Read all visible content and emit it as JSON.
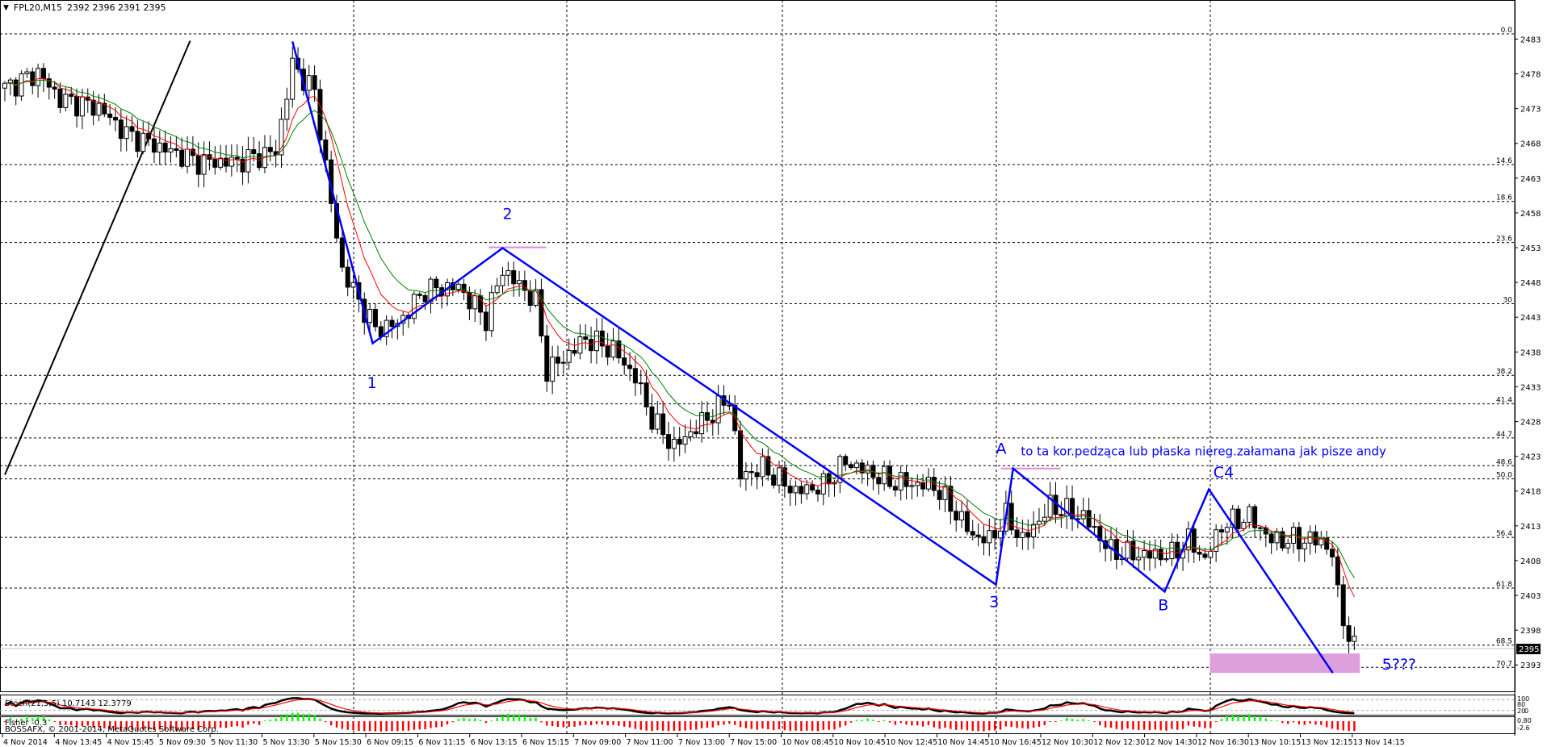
{
  "header": {
    "symbol": "FPL20,M15",
    "ohlc": "2392 2396 2391 2395"
  },
  "colors": {
    "bull_fill": "#ffffff",
    "bear_fill": "#000000",
    "ma_fast": "#ff0000",
    "ma_slow": "#008000",
    "wave": "#0000ff",
    "zone": "#dda0dd",
    "grid": "#000000",
    "fisher_up": "#00ff00",
    "fisher_down": "#ff0000"
  },
  "chart_data": {
    "type": "candlestick",
    "title": "FPL20,M15",
    "candle_count": 245,
    "close_keypoints": [
      [
        0,
        2475.6
      ],
      [
        6,
        2477.8
      ],
      [
        10,
        2474
      ],
      [
        17,
        2472.8
      ],
      [
        22,
        2469
      ],
      [
        30,
        2466.5
      ],
      [
        35,
        2465
      ],
      [
        42,
        2465
      ],
      [
        49,
        2466.5
      ],
      [
        52,
        2479
      ],
      [
        56,
        2475
      ],
      [
        59,
        2459
      ],
      [
        61,
        2449.5
      ],
      [
        64,
        2445
      ],
      [
        67,
        2441
      ],
      [
        71,
        2441.7
      ],
      [
        76,
        2446.6
      ],
      [
        82,
        2447
      ],
      [
        87,
        2442.4
      ],
      [
        90,
        2449.5
      ],
      [
        96,
        2445
      ],
      [
        98,
        2435
      ],
      [
        101,
        2436.7
      ],
      [
        105,
        2439.6
      ],
      [
        110,
        2438
      ],
      [
        114,
        2434
      ],
      [
        117,
        2428
      ],
      [
        121,
        2424
      ],
      [
        125,
        2426.8
      ],
      [
        131,
        2431
      ],
      [
        133,
        2419.8
      ],
      [
        137,
        2421
      ],
      [
        143,
        2417.6
      ],
      [
        148,
        2418.4
      ],
      [
        152,
        2421.9
      ],
      [
        160,
        2419
      ],
      [
        168,
        2418.4
      ],
      [
        171,
        2415.5
      ],
      [
        175,
        2411.3
      ],
      [
        178,
        2410.6
      ],
      [
        181,
        2414
      ],
      [
        184,
        2410.6
      ],
      [
        189,
        2415.5
      ],
      [
        195,
        2414
      ],
      [
        200,
        2409
      ],
      [
        205,
        2408.5
      ],
      [
        211,
        2408.5
      ],
      [
        214,
        2410.6
      ],
      [
        217,
        2407.8
      ],
      [
        220,
        2412.7
      ],
      [
        225,
        2414
      ],
      [
        229,
        2410.6
      ],
      [
        238,
        2410.6
      ],
      [
        240,
        2408.5
      ],
      [
        241,
        2402.8
      ],
      [
        243,
        2396.4
      ],
      [
        244,
        2395
      ]
    ],
    "last_price": 2395,
    "y_axis": {
      "ylim": [
        2389,
        2488
      ],
      "ticks": [
        "2483",
        "2478",
        "2473",
        "2468",
        "2463",
        "2458",
        "2453",
        "2448",
        "2443",
        "2438",
        "2433",
        "2428",
        "2423",
        "2418",
        "2413",
        "2408",
        "2403",
        "2398",
        "2393"
      ],
      "tick_values": [
        2483,
        2478,
        2473,
        2468,
        2463,
        2458,
        2453,
        2448,
        2443,
        2438,
        2433,
        2428,
        2423,
        2418,
        2413,
        2408,
        2403,
        2398,
        2393
      ]
    },
    "fib_levels": [
      {
        "label": "0.0",
        "price": 2483.4
      },
      {
        "label": "14.6",
        "price": 2464.6
      },
      {
        "label": "18.6",
        "price": 2459.3
      },
      {
        "label": "23.6",
        "price": 2453.4
      },
      {
        "label": "30",
        "price": 2444.6
      },
      {
        "label": "38.2",
        "price": 2434.3
      },
      {
        "label": "41.4",
        "price": 2430.2
      },
      {
        "label": "44.7",
        "price": 2425.3
      },
      {
        "label": "48.6",
        "price": 2421.3
      },
      {
        "label": "50.0",
        "price": 2419.4
      },
      {
        "label": "56.4",
        "price": 2411
      },
      {
        "label": "61.8",
        "price": 2403.7
      },
      {
        "label": "68.5",
        "price": 2395.5
      },
      {
        "label": "70.7",
        "price": 2392.3
      }
    ],
    "x_axis": {
      "ticks": [
        "4 Nov 2014",
        "4 Nov 13:45",
        "4 Nov 15:45",
        "5 Nov 09:30",
        "5 Nov 11:30",
        "5 Nov 13:30",
        "5 Nov 15:30",
        "6 Nov 09:15",
        "6 Nov 11:15",
        "6 Nov 13:15",
        "6 Nov 15:15",
        "7 Nov 09:00",
        "7 Nov 11:00",
        "7 Nov 13:00",
        "7 Nov 15:00",
        "10 Nov 08:45",
        "10 Nov 10:45",
        "10 Nov 12:45",
        "10 Nov 14:45",
        "10 Nov 16:45",
        "12 Nov 10:30",
        "12 Nov 12:30",
        "12 Nov 14:30",
        "12 Nov 16:30",
        "13 Nov 10:15",
        "13 Nov 12:15",
        "13 Nov 14:15"
      ]
    },
    "wave_line": [
      [
        52,
        2482.3
      ],
      [
        66.5,
        2438.9
      ],
      [
        90,
        2452.6
      ],
      [
        179.2,
        2404.2
      ],
      [
        182.3,
        2420.9
      ],
      [
        209.7,
        2403.2
      ],
      [
        217.7,
        2417.9
      ],
      [
        240.1,
        2391.5
      ]
    ],
    "trend_line": [
      [
        0,
        2420
      ],
      [
        33.5,
        2482.4
      ]
    ],
    "pink_marks": [
      [
        87.5,
        97.9,
        2452.7
      ],
      [
        180.1,
        190.9,
        2420.9
      ]
    ],
    "target_zone": {
      "from_index": 217.9,
      "to_index": 245,
      "price_top": 2394.3,
      "price_bottom": 2391.5
    },
    "wave_labels": [
      {
        "text": "1",
        "index": 65.5,
        "price": 2432.5
      },
      {
        "text": "2",
        "index": 90,
        "price": 2456.8
      },
      {
        "text": "3",
        "index": 178,
        "price": 2401
      },
      {
        "text": "A",
        "index": 179.2,
        "price": 2423
      },
      {
        "text": "B",
        "index": 208.5,
        "price": 2400.5
      },
      {
        "text": "C4",
        "index": 218.5,
        "price": 2419.6
      },
      {
        "text": "5???",
        "index": 249,
        "price": 2392
      }
    ],
    "annotation": {
      "text": "to ta kor.pedząca lub płaska niereg.załamana jak pisze andy",
      "index": 183.7,
      "price": 2422.8
    },
    "indicators": {
      "stoch": {
        "label": "Stoch(21,5,5) 10.7143 12.3779",
        "levels": [
          "100",
          "80",
          "20",
          "0"
        ]
      },
      "fisher": {
        "label": "Fisher -0.3",
        "levels": [
          "0.80",
          "-2.6"
        ]
      },
      "copyright": "BOSSAFX, © 2001-2014, MetaQuotes Software Corp."
    }
  }
}
